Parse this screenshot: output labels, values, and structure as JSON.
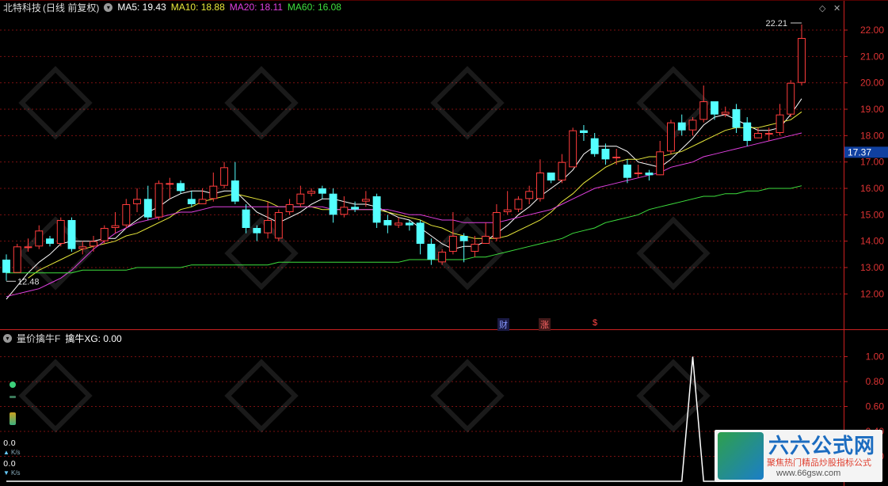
{
  "stock": {
    "name": "北特科技",
    "period": "(日线 前复权)",
    "ma": [
      {
        "label": "MA5: 19.43",
        "color": "#ffffff"
      },
      {
        "label": "MA10: 18.88",
        "color": "#e8e83a"
      },
      {
        "label": "MA20: 18.11",
        "color": "#e040e0"
      },
      {
        "label": "MA60: 16.08",
        "color": "#3ee03e"
      }
    ]
  },
  "indicator": {
    "name": "量价擒牛F",
    "value_label": "擒牛XG: 0.00"
  },
  "side_panel": {
    "speed_up": "0.0",
    "speed_down": "0.0",
    "unit": "K/s"
  },
  "badges": {
    "cai": "财",
    "zhang": "涨",
    "dollar": "$"
  },
  "watermark": {
    "title": "六六公式网",
    "subtitle": "聚焦热门精品炒股指标公式",
    "url": "www.66gsw.com"
  },
  "colors": {
    "up": "#ff3c3c",
    "down": "#54ffff",
    "axis": "#cc2020",
    "background": "#000000"
  },
  "chart_data": [
    {
      "type": "candlestick",
      "title": "北特科技 (日线 前复权)",
      "ylim": [
        11.2,
        22.6
      ],
      "y_ticks": [
        12.0,
        13.0,
        14.0,
        15.0,
        16.0,
        17.0,
        18.0,
        19.0,
        20.0,
        21.0,
        22.0
      ],
      "current_price_label": "17.37",
      "current_price": 17.37,
      "annotations": [
        {
          "label": "22.21",
          "value": 22.21,
          "note": "high"
        },
        {
          "label": "12.48",
          "value": 12.48,
          "note": "low"
        }
      ],
      "candles": [
        [
          13.3,
          12.8,
          13.5,
          12.5
        ],
        [
          12.8,
          13.8,
          13.9,
          12.8
        ],
        [
          13.8,
          13.8,
          14.1,
          13.6
        ],
        [
          13.8,
          14.4,
          14.6,
          13.7
        ],
        [
          14.1,
          13.9,
          14.2,
          13.8
        ],
        [
          13.9,
          14.8,
          14.9,
          13.8
        ],
        [
          14.8,
          13.7,
          14.9,
          13.6
        ],
        [
          13.7,
          13.8,
          14.0,
          13.5
        ],
        [
          13.8,
          14.0,
          14.2,
          13.6
        ],
        [
          14.0,
          14.5,
          14.6,
          13.9
        ],
        [
          14.5,
          14.6,
          15.1,
          14.3
        ],
        [
          14.6,
          15.4,
          15.6,
          14.5
        ],
        [
          15.4,
          15.6,
          16.0,
          15.1
        ],
        [
          15.6,
          14.9,
          16.1,
          14.8
        ],
        [
          14.9,
          16.2,
          16.3,
          14.8
        ],
        [
          16.2,
          16.2,
          16.4,
          15.6
        ],
        [
          16.2,
          15.9,
          16.3,
          15.8
        ],
        [
          15.6,
          15.4,
          15.9,
          15.3
        ],
        [
          15.4,
          15.6,
          16.0,
          15.4
        ],
        [
          15.6,
          16.1,
          16.6,
          15.5
        ],
        [
          16.1,
          16.8,
          17.0,
          16.0
        ],
        [
          16.3,
          15.5,
          17.0,
          15.4
        ],
        [
          15.2,
          14.5,
          15.4,
          14.3
        ],
        [
          14.5,
          14.3,
          14.6,
          14.0
        ],
        [
          14.3,
          14.8,
          15.5,
          14.1
        ],
        [
          14.1,
          15.1,
          15.2,
          14.0
        ],
        [
          15.1,
          15.4,
          15.6,
          15.0
        ],
        [
          15.4,
          15.8,
          16.1,
          15.3
        ],
        [
          15.8,
          15.9,
          16.0,
          15.7
        ],
        [
          16.0,
          15.8,
          16.1,
          15.6
        ],
        [
          15.8,
          15.0,
          16.0,
          14.7
        ],
        [
          15.0,
          15.3,
          15.7,
          14.9
        ],
        [
          15.3,
          15.2,
          15.5,
          15.1
        ],
        [
          15.5,
          15.6,
          15.9,
          15.3
        ],
        [
          15.7,
          14.7,
          15.8,
          14.5
        ],
        [
          14.8,
          14.6,
          15.0,
          14.3
        ],
        [
          14.6,
          14.7,
          14.9,
          14.5
        ],
        [
          14.7,
          14.6,
          14.8,
          14.4
        ],
        [
          14.7,
          13.9,
          14.8,
          13.5
        ],
        [
          13.9,
          13.3,
          14.1,
          13.1
        ],
        [
          13.2,
          13.6,
          13.7,
          13.1
        ],
        [
          13.6,
          14.2,
          15.1,
          13.5
        ],
        [
          14.2,
          14.0,
          14.3,
          13.2
        ],
        [
          13.6,
          13.9,
          14.2,
          13.4
        ],
        [
          13.9,
          14.2,
          14.7,
          13.9
        ],
        [
          14.1,
          15.1,
          15.4,
          14.0
        ],
        [
          15.1,
          15.2,
          15.9,
          15.0
        ],
        [
          15.2,
          15.6,
          15.7,
          15.1
        ],
        [
          15.6,
          15.9,
          16.1,
          15.4
        ],
        [
          15.6,
          16.6,
          17.1,
          15.5
        ],
        [
          16.6,
          16.3,
          16.6,
          16.2
        ],
        [
          16.3,
          17.0,
          17.3,
          16.2
        ],
        [
          16.8,
          18.2,
          18.3,
          16.8
        ],
        [
          18.2,
          18.1,
          18.4,
          17.8
        ],
        [
          17.9,
          17.3,
          18.1,
          17.2
        ],
        [
          17.5,
          17.1,
          17.7,
          16.9
        ],
        [
          17.2,
          17.2,
          17.5,
          16.9
        ],
        [
          16.9,
          16.4,
          17.1,
          16.2
        ],
        [
          16.6,
          16.6,
          16.9,
          16.4
        ],
        [
          16.6,
          16.5,
          16.7,
          16.3
        ],
        [
          16.5,
          17.4,
          17.8,
          16.5
        ],
        [
          17.4,
          18.5,
          18.6,
          17.3
        ],
        [
          18.5,
          18.2,
          18.8,
          18.0
        ],
        [
          18.2,
          18.6,
          18.7,
          18.0
        ],
        [
          18.6,
          19.3,
          19.9,
          18.5
        ],
        [
          19.3,
          18.8,
          19.3,
          18.6
        ],
        [
          18.8,
          18.9,
          19.1,
          18.7
        ],
        [
          19.0,
          18.3,
          19.2,
          18.1
        ],
        [
          18.5,
          17.8,
          18.7,
          17.6
        ],
        [
          17.9,
          18.1,
          18.3,
          17.9
        ],
        [
          18.1,
          18.1,
          18.3,
          17.8
        ],
        [
          18.1,
          18.8,
          19.2,
          18.0
        ],
        [
          18.8,
          20.0,
          20.1,
          18.7
        ],
        [
          20.0,
          21.7,
          22.21,
          19.9
        ]
      ],
      "series": [
        {
          "name": "MA5",
          "color": "#ffffff",
          "values": [
            11.8,
            12.3,
            12.8,
            13.2,
            13.5,
            13.9,
            14.0,
            14.0,
            14.0,
            14.1,
            14.1,
            14.5,
            14.8,
            15.1,
            15.3,
            15.6,
            15.8,
            15.9,
            15.9,
            15.8,
            15.9,
            15.9,
            15.5,
            15.1,
            14.9,
            14.7,
            14.9,
            15.1,
            15.4,
            15.6,
            15.6,
            15.5,
            15.4,
            15.4,
            15.3,
            15.1,
            14.9,
            14.8,
            14.5,
            14.2,
            13.9,
            13.7,
            13.8,
            13.8,
            14.0,
            14.3,
            14.6,
            15.0,
            15.3,
            15.7,
            16.0,
            16.3,
            16.7,
            17.3,
            17.6,
            17.6,
            17.6,
            17.4,
            17.0,
            16.9,
            16.8,
            17.1,
            17.5,
            17.9,
            18.4,
            18.7,
            18.8,
            18.6,
            18.4,
            18.2,
            18.2,
            18.3,
            18.8,
            19.4
          ]
        },
        {
          "name": "MA10",
          "color": "#e8e83a",
          "values": [
            null,
            null,
            12.6,
            12.9,
            13.1,
            13.3,
            13.5,
            13.7,
            13.8,
            13.9,
            14.0,
            14.2,
            14.3,
            14.5,
            14.7,
            14.9,
            15.2,
            15.3,
            15.5,
            15.6,
            15.7,
            15.8,
            15.7,
            15.6,
            15.5,
            15.3,
            15.3,
            15.3,
            15.3,
            15.2,
            15.2,
            15.2,
            15.2,
            15.2,
            15.2,
            15.1,
            15.0,
            14.9,
            14.8,
            14.6,
            14.5,
            14.3,
            14.2,
            14.1,
            14.1,
            14.1,
            14.2,
            14.4,
            14.6,
            14.8,
            15.1,
            15.5,
            15.8,
            16.2,
            16.5,
            16.8,
            17.0,
            17.1,
            17.1,
            17.2,
            17.2,
            17.3,
            17.4,
            17.6,
            17.8,
            18.0,
            18.2,
            18.3,
            18.3,
            18.3,
            18.4,
            18.5,
            18.6,
            18.9
          ]
        },
        {
          "name": "MA20",
          "color": "#e040e0",
          "values": [
            11.9,
            12.0,
            12.1,
            12.2,
            12.4,
            12.6,
            12.9,
            13.3,
            13.7,
            14.0,
            14.3,
            14.5,
            14.7,
            14.8,
            14.9,
            15.0,
            15.1,
            15.1,
            15.2,
            15.3,
            15.3,
            15.3,
            15.3,
            15.3,
            15.3,
            15.3,
            15.3,
            15.3,
            15.3,
            15.3,
            15.2,
            15.2,
            15.2,
            15.2,
            15.2,
            15.2,
            15.1,
            15.0,
            15.0,
            14.9,
            14.8,
            14.8,
            14.7,
            14.7,
            14.7,
            14.7,
            14.8,
            14.9,
            15.0,
            15.1,
            15.2,
            15.4,
            15.6,
            15.8,
            16.0,
            16.1,
            16.2,
            16.3,
            16.4,
            16.5,
            16.6,
            16.8,
            16.9,
            17.0,
            17.2,
            17.3,
            17.4,
            17.5,
            17.6,
            17.7,
            17.8,
            17.9,
            18.0,
            18.1
          ]
        },
        {
          "name": "MA60",
          "color": "#3ee03e",
          "values": [
            12.8,
            12.8,
            12.8,
            12.8,
            12.8,
            12.8,
            12.8,
            12.9,
            12.9,
            12.9,
            12.9,
            12.9,
            13.0,
            13.0,
            13.0,
            13.0,
            13.0,
            13.1,
            13.1,
            13.1,
            13.1,
            13.1,
            13.1,
            13.1,
            13.1,
            13.2,
            13.2,
            13.2,
            13.2,
            13.2,
            13.2,
            13.2,
            13.2,
            13.2,
            13.2,
            13.2,
            13.2,
            13.3,
            13.3,
            13.3,
            13.3,
            13.3,
            13.3,
            13.4,
            13.4,
            13.5,
            13.6,
            13.7,
            13.8,
            13.9,
            14.0,
            14.1,
            14.3,
            14.4,
            14.5,
            14.7,
            14.8,
            14.9,
            15.0,
            15.2,
            15.3,
            15.4,
            15.5,
            15.6,
            15.7,
            15.7,
            15.8,
            15.8,
            15.9,
            15.9,
            16.0,
            16.0,
            16.0,
            16.1
          ]
        }
      ]
    },
    {
      "type": "line",
      "title": "量价擒牛F",
      "ylim": [
        0,
        1.08
      ],
      "y_ticks": [
        0.2,
        0.4,
        0.6,
        0.8,
        1.0
      ],
      "series": [
        {
          "name": "擒牛XG",
          "color": "#ffffff",
          "values": [
            0,
            0,
            0,
            0,
            0,
            0,
            0,
            0,
            0,
            0,
            0,
            0,
            0,
            0,
            0,
            0,
            0,
            0,
            0,
            0,
            0,
            0,
            0,
            0,
            0,
            0,
            0,
            0,
            0,
            0,
            0,
            0,
            0,
            0,
            0,
            0,
            0,
            0,
            0,
            0,
            0,
            0,
            0,
            0,
            0,
            0,
            0,
            0,
            0,
            0,
            0,
            0,
            0,
            0,
            0,
            0,
            0,
            0,
            0,
            0,
            0,
            0,
            0,
            1,
            0,
            0,
            0,
            0,
            0,
            0,
            0,
            0,
            0,
            0
          ]
        }
      ]
    }
  ]
}
